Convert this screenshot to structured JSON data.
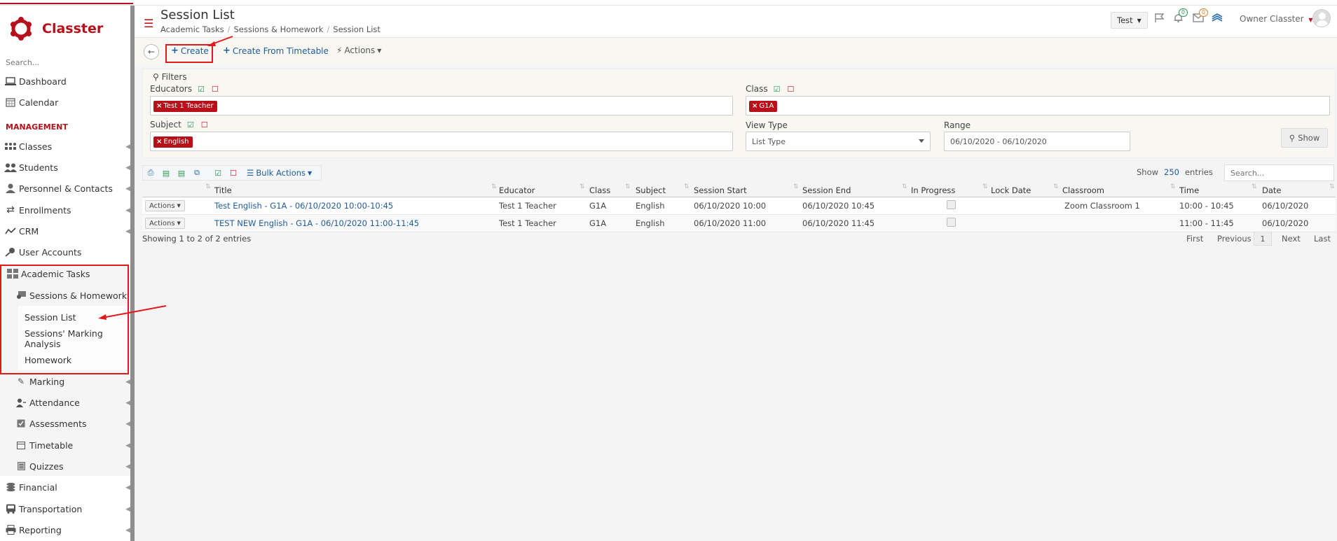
{
  "brand": {
    "name": "Classter",
    "color": "#b8101b"
  },
  "sidebar": {
    "search_placeholder": "Search...",
    "section_management": "MANAGEMENT",
    "items": [
      {
        "label": "Dashboard",
        "icon": "laptop-icon"
      },
      {
        "label": "Calendar",
        "icon": "calendar-icon"
      },
      {
        "label": "Classes",
        "icon": "classes-icon"
      },
      {
        "label": "Students",
        "icon": "students-icon"
      },
      {
        "label": "Personnel & Contacts",
        "icon": "person-icon"
      },
      {
        "label": "Enrollments",
        "icon": "swap-icon"
      },
      {
        "label": "CRM",
        "icon": "crm-icon"
      },
      {
        "label": "User Accounts",
        "icon": "key-icon"
      },
      {
        "label": "Academic Tasks",
        "icon": "grid-icon"
      },
      {
        "label": "Sessions & Homework",
        "icon": "sessions-icon"
      },
      {
        "label": "Session List",
        "icon": ""
      },
      {
        "label": "Sessions' Marking Analysis",
        "icon": ""
      },
      {
        "label": "Homework",
        "icon": ""
      },
      {
        "label": "Marking",
        "icon": "edit-icon"
      },
      {
        "label": "Attendance",
        "icon": "user-check-icon"
      },
      {
        "label": "Assessments",
        "icon": "check-square-icon"
      },
      {
        "label": "Timetable",
        "icon": "table-icon"
      },
      {
        "label": "Quizzes",
        "icon": "list-icon"
      },
      {
        "label": "Financial",
        "icon": "coins-icon"
      },
      {
        "label": "Transportation",
        "icon": "bus-icon"
      },
      {
        "label": "Reporting",
        "icon": "printer-icon"
      }
    ]
  },
  "header": {
    "title": "Session List",
    "breadcrumb": [
      "Academic Tasks",
      "Sessions & Homework",
      "Session List"
    ],
    "test_dropdown": "Test",
    "notifications_count": "0",
    "messages_count": "0",
    "user_name": "Owner Classter"
  },
  "toolbar": {
    "create_label": "Create",
    "create_from_timetable_label": "Create From Timetable",
    "actions_label": "Actions"
  },
  "filters": {
    "title": "Filters",
    "educators_label": "Educators",
    "educators_chip": "Test 1 Teacher",
    "class_label": "Class",
    "class_chip": "G1A",
    "subject_label": "Subject",
    "subject_chip": "English",
    "view_type_label": "View Type",
    "view_type_value": "List Type",
    "range_label": "Range",
    "range_value": "06/10/2020 - 06/10/2020",
    "show_label": "Show"
  },
  "table": {
    "bulk_actions_label": "Bulk Actions",
    "show_label": "Show",
    "show_count": "250",
    "entries_label": "entries",
    "search_placeholder": "Search...",
    "columns": [
      "Title",
      "Educator",
      "Class",
      "Subject",
      "Session Start",
      "Session End",
      "In Progress",
      "Lock Date",
      "Classroom",
      "Time",
      "Date"
    ],
    "row_action_label": "Actions",
    "rows": [
      {
        "title": "Test English - G1A - 06/10/2020 10:00-10:45",
        "educator": "Test 1 Teacher",
        "class": "G1A",
        "subject": "English",
        "session_start": "06/10/2020 10:00",
        "session_end": "06/10/2020 10:45",
        "lock_date": "",
        "classroom": "Zoom Classroom 1",
        "time": "10:00 - 10:45",
        "date": "06/10/2020"
      },
      {
        "title": "TEST NEW English - G1A - 06/10/2020 11:00-11:45",
        "educator": "Test 1 Teacher",
        "class": "G1A",
        "subject": "English",
        "session_start": "06/10/2020 11:00",
        "session_end": "06/10/2020 11:45",
        "lock_date": "",
        "classroom": "",
        "time": "11:00 - 11:45",
        "date": "06/10/2020"
      }
    ],
    "info": "Showing 1 to 2 of 2 entries",
    "pager": {
      "first": "First",
      "previous": "Previous",
      "current": "1",
      "next": "Next",
      "last": "Last"
    }
  },
  "colors": {
    "accent": "#b8101b",
    "link": "#1f5c99",
    "annotation": "#e11b1b",
    "check": "#2b9b54"
  }
}
